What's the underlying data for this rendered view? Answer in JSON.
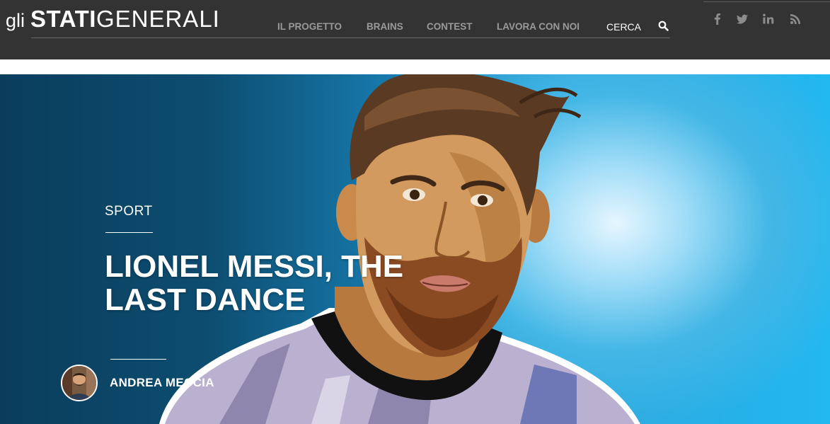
{
  "header": {
    "logo": {
      "prefix": "gli",
      "bold": "STATI",
      "light": "GENERALI"
    },
    "nav": [
      {
        "label": "IL PROGETTO",
        "name": "nav-il-progetto"
      },
      {
        "label": "BRAINS",
        "name": "nav-brains"
      },
      {
        "label": "CONTEST",
        "name": "nav-contest"
      },
      {
        "label": "LAVORA CON NOI",
        "name": "nav-lavora-con-noi"
      }
    ],
    "search_label": "CERCA",
    "social_icons": [
      "facebook-icon",
      "twitter-icon",
      "linkedin-icon",
      "rss-icon"
    ]
  },
  "hero": {
    "category": "SPORT",
    "title": "LIONEL MESSI, THE LAST DANCE",
    "author": "ANDREA MECCIA"
  },
  "colors": {
    "header_bg": "#333333",
    "nav_text": "#9a9a9a",
    "hero_dark": "#0a3d5c",
    "hero_light": "#22b8f0"
  }
}
